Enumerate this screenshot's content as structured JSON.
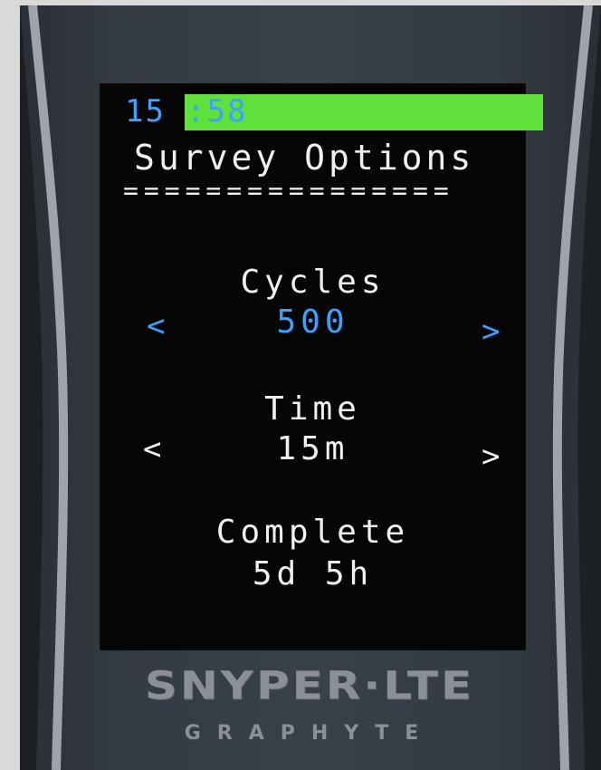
{
  "device": {
    "brand": "SNYPER·LTE",
    "maker": "GRAPHYTE"
  },
  "status": {
    "clock_hours": "15",
    "clock_separator": ":",
    "clock_minutes": "58",
    "battery_level": 1.0,
    "battery_color": "#5fe03a"
  },
  "screen": {
    "title": "Survey Options",
    "title_rule": "================",
    "fields": [
      {
        "label": "Cycles",
        "value": "500",
        "prev_arrow": "<",
        "next_arrow": ">"
      },
      {
        "label": "Time",
        "value": "15m",
        "prev_arrow": "<",
        "next_arrow": ">"
      },
      {
        "label": "Complete",
        "value": "5d 5h"
      }
    ]
  },
  "colors": {
    "accent": "#3aa2ff",
    "text": "#f0f0f0",
    "screen_bg": "#050505"
  }
}
